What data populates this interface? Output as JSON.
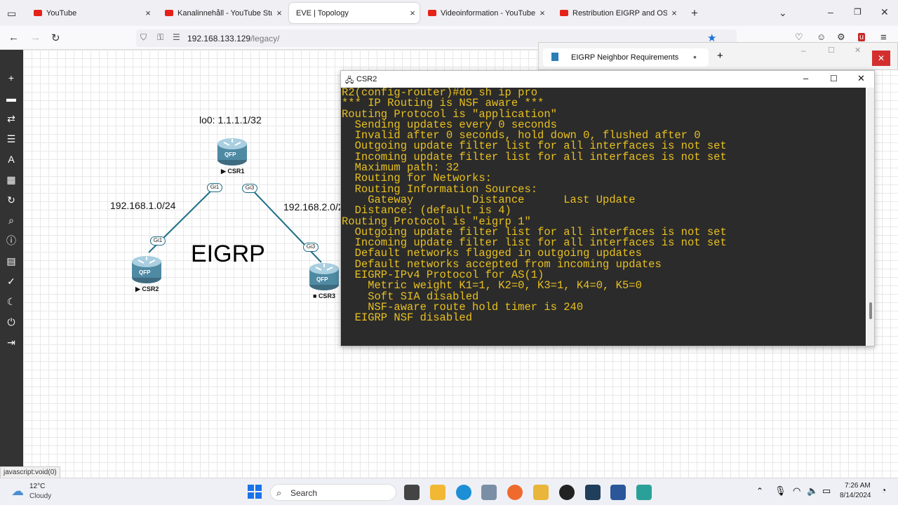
{
  "browser": {
    "tabs": [
      {
        "title": "YouTube",
        "close": "×"
      },
      {
        "title": "Kanalinnehåll - YouTube Studio",
        "close": "×"
      },
      {
        "title": "EVE | Topology",
        "close": "×"
      },
      {
        "title": "Videoinformation - YouTube St",
        "close": "×"
      },
      {
        "title": "Restribution EIGRP and OSPF |",
        "close": "×"
      }
    ],
    "new_tab": "+",
    "url_host": "192.168.133.129",
    "url_path": "/legacy/"
  },
  "topology": {
    "loopback_label": "lo0: 1.1.1.1/32",
    "net_left": "192.168.1.0/24",
    "net_right": "192.168.2.0/2",
    "protocol_label": "EIGRP",
    "routers": [
      {
        "name": "CSR1",
        "icon_text": "QFP"
      },
      {
        "name": "CSR2",
        "icon_text": "QFP"
      },
      {
        "name": "CSR3",
        "icon_text": "QFP"
      }
    ],
    "ports": [
      "Gi1",
      "Gi3",
      "Gi1",
      "Gi3"
    ]
  },
  "background_window": {
    "tab_title": "EIGRP Neighbor Requirements",
    "new_tab": "+"
  },
  "terminal": {
    "title": "CSR2",
    "lines": [
      "R2(config-router)#do sh ip pro",
      "*** IP Routing is NSF aware ***",
      "",
      "Routing Protocol is \"application\"",
      "  Sending updates every 0 seconds",
      "  Invalid after 0 seconds, hold down 0, flushed after 0",
      "  Outgoing update filter list for all interfaces is not set",
      "  Incoming update filter list for all interfaces is not set",
      "  Maximum path: 32",
      "  Routing for Networks:",
      "  Routing Information Sources:",
      "    Gateway         Distance      Last Update",
      "  Distance: (default is 4)",
      "",
      "Routing Protocol is \"eigrp 1\"",
      "  Outgoing update filter list for all interfaces is not set",
      "  Incoming update filter list for all interfaces is not set",
      "  Default networks flagged in outgoing updates",
      "  Default networks accepted from incoming updates",
      "  EIGRP-IPv4 Protocol for AS(1)",
      "    Metric weight K1=1, K2=0, K3=1, K4=0, K5=0",
      "    Soft SIA disabled",
      "    NSF-aware route hold timer is 240",
      "  EIGRP NSF disabled"
    ]
  },
  "status_text": "javascript:void(0)",
  "taskbar": {
    "weather_temp": "12°C",
    "weather_desc": "Cloudy",
    "search_placeholder": "Search",
    "time": "7:26 AM",
    "date": "8/14/2024"
  }
}
